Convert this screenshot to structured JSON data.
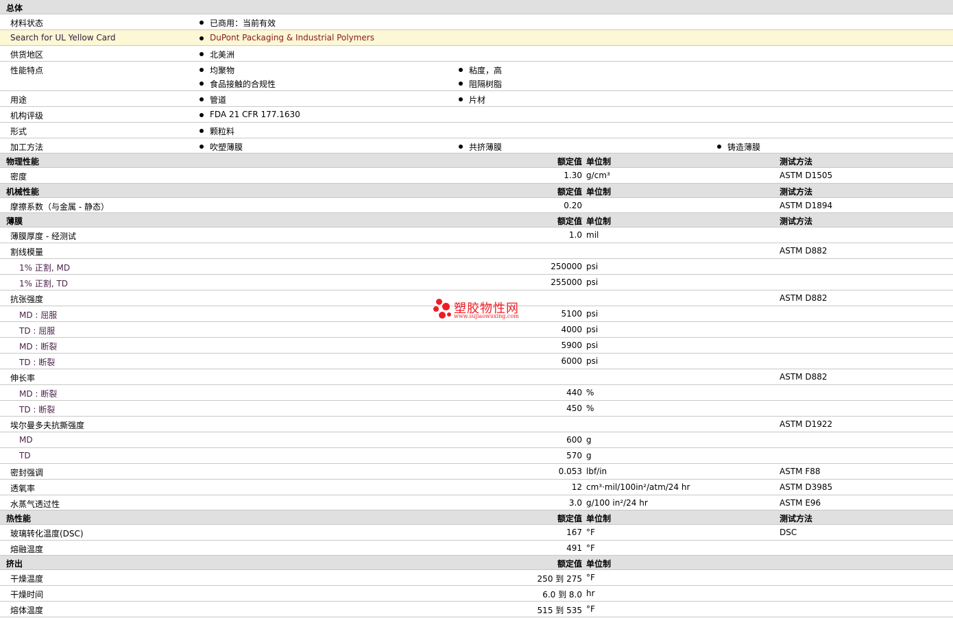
{
  "general": {
    "title": "总体",
    "rows": [
      {
        "label": "材料状态",
        "items": [
          "已商用：当前有效"
        ]
      },
      {
        "label": "Search for UL Yellow Card",
        "items": [
          "DuPont Packaging & Industrial Polymers"
        ]
      },
      {
        "label": "供货地区",
        "items": [
          "北美洲"
        ]
      },
      {
        "label": "性能特点",
        "items": [
          "均聚物",
          "粘度，高",
          "食品接触的合规性",
          "阻隔树脂"
        ]
      },
      {
        "label": "用途",
        "items": [
          "管道",
          "片材"
        ]
      },
      {
        "label": "机构评级",
        "items": [
          "FDA 21 CFR 177.1630"
        ]
      },
      {
        "label": "形式",
        "items": [
          "颗粒料"
        ]
      },
      {
        "label": "加工方法",
        "items": [
          "吹塑薄膜",
          "共挤薄膜",
          "铸造薄膜"
        ]
      }
    ]
  },
  "headers": {
    "nominal": "额定值",
    "unit": "单位制",
    "method": "测试方法"
  },
  "physical": {
    "title": "物理性能",
    "rows": [
      {
        "label": "密度",
        "value": "1.30",
        "unit": "g/cm³",
        "method": "ASTM D1505"
      }
    ]
  },
  "mechanical": {
    "title": "机械性能",
    "rows": [
      {
        "label": "摩擦系数（与金属 - 静态）",
        "value": "0.20",
        "unit": "",
        "method": "ASTM D1894"
      }
    ]
  },
  "film": {
    "title": "薄膜",
    "rows": [
      {
        "label": "薄膜厚度 - 经测试",
        "value": "1.0",
        "unit": "mil",
        "method": ""
      },
      {
        "label": "割线模量",
        "value": "",
        "unit": "",
        "method": "ASTM D882"
      },
      {
        "label": "1% 正割, MD",
        "value": "250000",
        "unit": "psi",
        "method": ""
      },
      {
        "label": "1% 正割, TD",
        "value": "255000",
        "unit": "psi",
        "method": ""
      },
      {
        "label": "抗张强度",
        "value": "",
        "unit": "",
        "method": "ASTM D882"
      },
      {
        "label": "MD : 屈服",
        "value": "5100",
        "unit": "psi",
        "method": ""
      },
      {
        "label": "TD : 屈服",
        "value": "4000",
        "unit": "psi",
        "method": ""
      },
      {
        "label": "MD : 断裂",
        "value": "5900",
        "unit": "psi",
        "method": ""
      },
      {
        "label": "TD : 断裂",
        "value": "6000",
        "unit": "psi",
        "method": ""
      },
      {
        "label": "伸长率",
        "value": "",
        "unit": "",
        "method": "ASTM D882"
      },
      {
        "label": "MD : 断裂",
        "value": "440",
        "unit": "%",
        "method": ""
      },
      {
        "label": "TD : 断裂",
        "value": "450",
        "unit": "%",
        "method": ""
      },
      {
        "label": "埃尔曼多夫抗撕强度",
        "value": "",
        "unit": "",
        "method": "ASTM D1922"
      },
      {
        "label": "MD",
        "value": "600",
        "unit": "g",
        "method": ""
      },
      {
        "label": "TD",
        "value": "570",
        "unit": "g",
        "method": ""
      },
      {
        "label": "密封强调",
        "value": "0.053",
        "unit": "lbf/in",
        "method": "ASTM F88"
      },
      {
        "label": "透氧率",
        "value": "12",
        "unit": "cm³·mil/100in²/atm/24 hr",
        "method": "ASTM D3985"
      },
      {
        "label": "水蒸气透过性",
        "value": "3.0",
        "unit": "g/100 in²/24 hr",
        "method": "ASTM E96"
      }
    ]
  },
  "thermal": {
    "title": "热性能",
    "rows": [
      {
        "label": "玻璃转化温度(DSC)",
        "value": "167",
        "unit": "°F",
        "method": "DSC"
      },
      {
        "label": "熔融温度",
        "value": "491",
        "unit": "°F",
        "method": ""
      }
    ]
  },
  "extrusion": {
    "title": "挤出",
    "rows": [
      {
        "label": "干燥温度",
        "value": "250 到  275",
        "unit": "°F",
        "method": ""
      },
      {
        "label": "干燥时间",
        "value": "6.0 到  8.0",
        "unit": "hr",
        "method": ""
      },
      {
        "label": "熔体温度",
        "value": "515 到  535",
        "unit": "°F",
        "method": ""
      }
    ]
  },
  "watermark": {
    "cn": "塑胶物性网",
    "en": "www.sujiaowuxing.com"
  }
}
